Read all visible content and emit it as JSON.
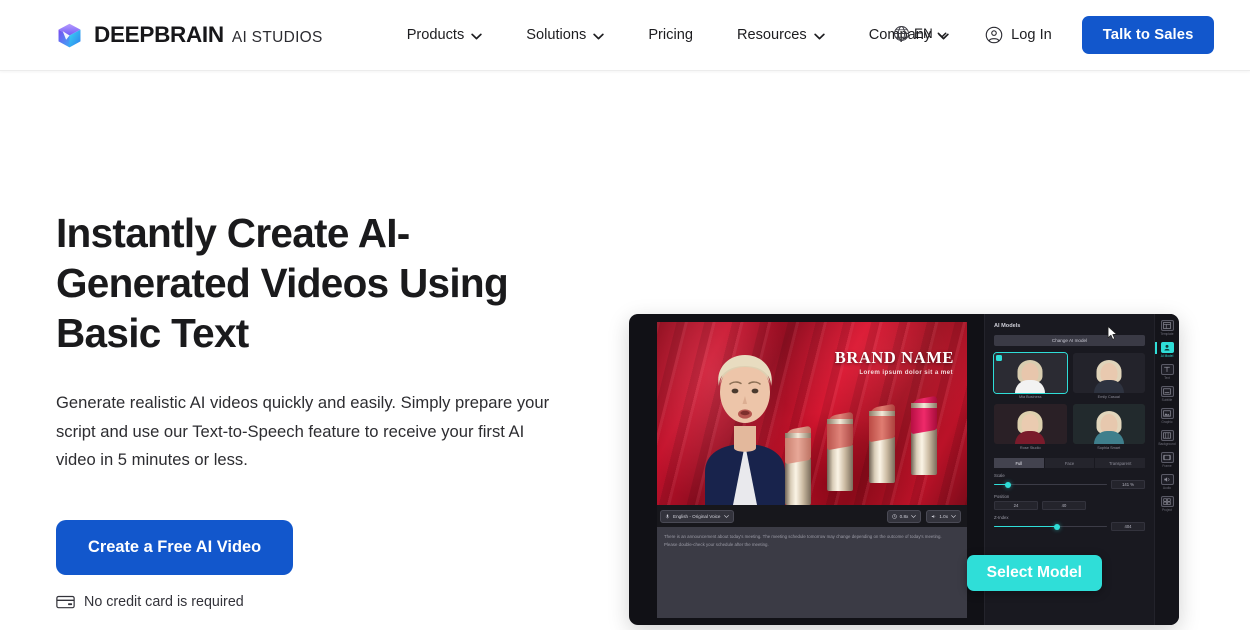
{
  "brand": {
    "name": "DEEPBRAIN",
    "product": "AI STUDIOS",
    "logo_icon": "cube-logo-icon"
  },
  "nav": {
    "items": [
      {
        "label": "Products",
        "has_dropdown": true
      },
      {
        "label": "Solutions",
        "has_dropdown": true
      },
      {
        "label": "Pricing",
        "has_dropdown": false
      },
      {
        "label": "Resources",
        "has_dropdown": true
      },
      {
        "label": "Company",
        "has_dropdown": true
      }
    ],
    "language": {
      "label": "EN",
      "icon": "globe-icon"
    },
    "login": {
      "label": "Log In",
      "icon": "user-circle-icon"
    },
    "cta": {
      "label": "Talk to Sales"
    }
  },
  "hero": {
    "headline": "Instantly Create AI-Generated Videos Using Basic Text",
    "subcopy": "Generate realistic AI videos quickly and easily. Simply prepare your script and use our Text-to-Speech feature to receive your first AI video in 5 minutes or less.",
    "cta_label": "Create a Free AI Video",
    "note": "No credit card is required",
    "note_icon": "credit-card-icon"
  },
  "preview": {
    "canvas": {
      "brand_title": "BRAND NAME",
      "brand_sub": "Lorem ipsum dolor sit a met"
    },
    "toolbar": {
      "voice_pill": "English - Original Voice",
      "voice_icon": "mic-icon",
      "speed_pill": "0.8x",
      "speed_icon": "clock-icon",
      "zoom_pill": "1.0x",
      "zoom_icon": "volume-icon"
    },
    "script_placeholder": "There is an announcement about today's meeting. The meeting schedule tomorrow may change depending on the outcome of today's meeting. Please double-check your schedule after the meeting.",
    "select_model_button": "Select Model",
    "panel": {
      "title": "AI Models",
      "change_button": "Change AI model",
      "models": [
        {
          "name": "Mia Business",
          "selected": true,
          "hair": "#d9cdb0",
          "skin": "#e8c6ac",
          "body": "#f2f2f2",
          "bg": "#2b2b33"
        },
        {
          "name": "Emily Casual",
          "selected": false,
          "hair": "#e0d4ba",
          "skin": "#e9c9af",
          "body": "#2e3340",
          "bg": "#23232b"
        },
        {
          "name": "Rose Studio",
          "selected": false,
          "hair": "#ddd0ae",
          "skin": "#eacbb0",
          "body": "#7a1b2b",
          "bg": "#2a2026"
        },
        {
          "name": "Sophia Smart",
          "selected": false,
          "hair": "#e2d6bc",
          "skin": "#e7c8ae",
          "body": "#3f7f8c",
          "bg": "#222a2d"
        }
      ],
      "tabs": [
        {
          "label": "Full",
          "active": true
        },
        {
          "label": "Face",
          "active": false
        },
        {
          "label": "Transparent",
          "active": false
        }
      ],
      "controls": [
        {
          "label": "Scale",
          "type": "slider",
          "fill_pct": 12,
          "value": "141 %"
        },
        {
          "label": "Position",
          "type": "pair",
          "value_x": "24",
          "value_y": "40"
        },
        {
          "label": "Z-Index",
          "type": "slider",
          "fill_pct": 56,
          "value": "404"
        }
      ]
    },
    "rail": [
      {
        "label": "Template",
        "icon": "template-icon",
        "active": false
      },
      {
        "label": "AI Model",
        "icon": "avatar-icon",
        "active": true
      },
      {
        "label": "Text",
        "icon": "text-icon",
        "active": false
      },
      {
        "label": "Subtitle",
        "icon": "subtitle-icon",
        "active": false
      },
      {
        "label": "Graphic",
        "icon": "image-icon",
        "active": false
      },
      {
        "label": "Background",
        "icon": "background-icon",
        "active": false
      },
      {
        "label": "Frame",
        "icon": "frame-icon",
        "active": false
      },
      {
        "label": "Audio",
        "icon": "audio-icon",
        "active": false
      },
      {
        "label": "Project",
        "icon": "project-icon",
        "active": false
      }
    ]
  },
  "colors": {
    "brand_blue": "#1257cc",
    "accent_cyan": "#2fded8",
    "text_dark": "#1a1a1c",
    "app_bg": "#111116"
  }
}
